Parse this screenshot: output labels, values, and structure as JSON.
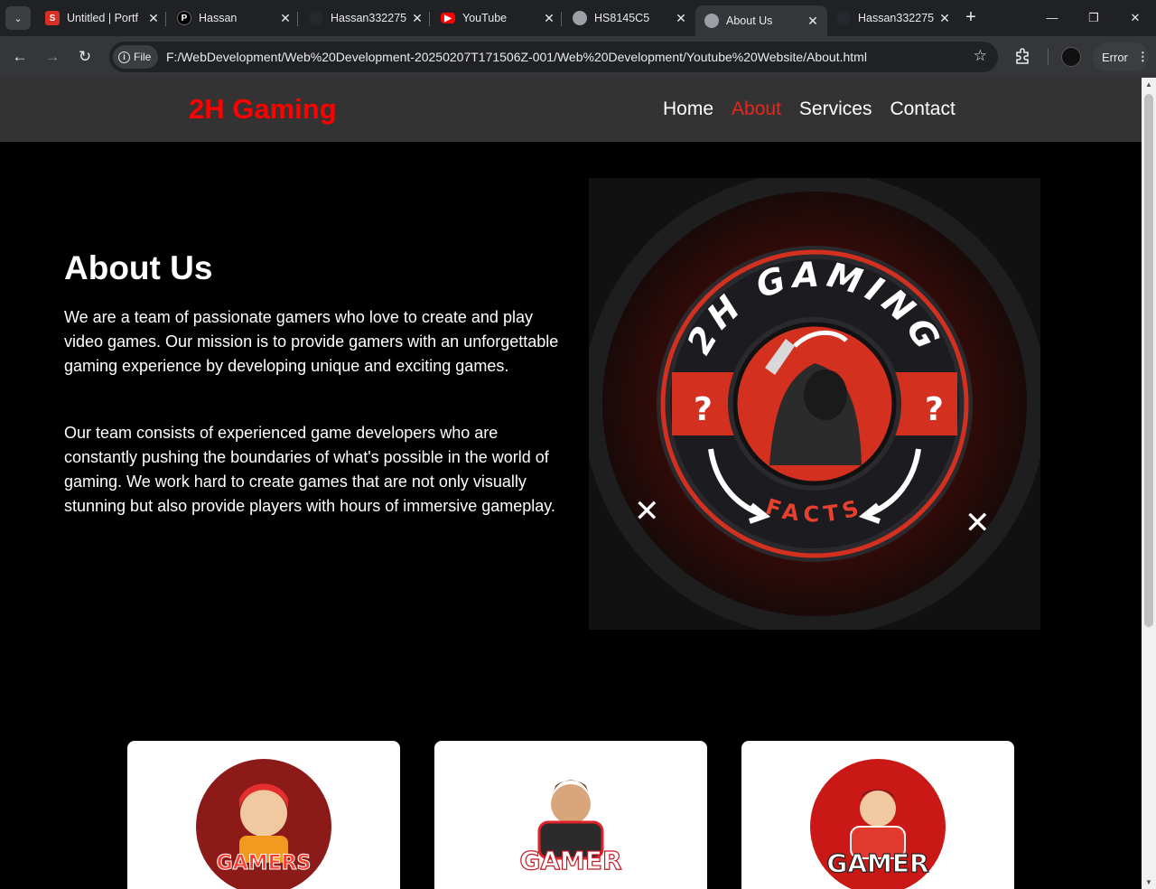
{
  "browser": {
    "tabs": [
      {
        "title": "Untitled | Portf",
        "favicon": "s-red-icon",
        "color": "#d93025"
      },
      {
        "title": "Hassan",
        "favicon": "p-black-icon",
        "color": "#000000"
      },
      {
        "title": "Hassan332275",
        "favicon": "github-icon",
        "color": "#24292e"
      },
      {
        "title": "YouTube",
        "favicon": "youtube-icon",
        "color": "#ff0000"
      },
      {
        "title": "HS8145C5",
        "favicon": "globe-icon",
        "color": "#9aa0a6"
      },
      {
        "title": "About Us",
        "favicon": "globe-icon",
        "color": "#9aa0a6",
        "active": true
      },
      {
        "title": "Hassan332275",
        "favicon": "github-icon",
        "color": "#24292e"
      }
    ],
    "chip_label": "File",
    "url": "F:/WebDevelopment/Web%20Development-20250207T171506Z-001/Web%20Development/Youtube%20Website/About.html",
    "error_label": "Error"
  },
  "site": {
    "brand": "2H Gaming",
    "brand_color": "#ff0000",
    "nav": [
      {
        "label": "Home",
        "active": false
      },
      {
        "label": "About",
        "active": true
      },
      {
        "label": "Services",
        "active": false
      },
      {
        "label": "Contact",
        "active": false
      }
    ],
    "about": {
      "title": "About Us",
      "p1": "We are a team of passionate gamers who love to create and play video games. Our mission is to provide gamers with an unforgettable gaming experience by developing unique and exciting games.",
      "p2": "Our team consists of experienced game developers who are constantly pushing the boundaries of what's possible in the world of gaming. We work hard to create games that are not only visually stunning but also provide players with hours of immersive gameplay."
    },
    "logo": {
      "top_text": "2H GAMING",
      "bottom_text": "FACTS"
    },
    "cards": [
      {
        "badge": "GAMERS"
      },
      {
        "badge": "GAMER"
      },
      {
        "badge": "GAMER"
      }
    ]
  }
}
